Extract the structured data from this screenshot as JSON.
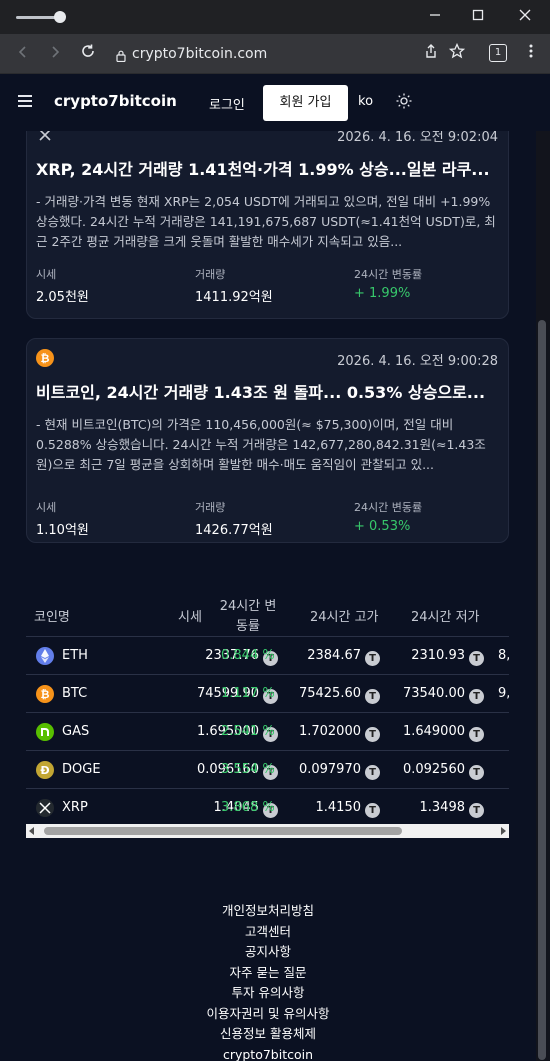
{
  "browser": {
    "url": "crypto7bitcoin.com",
    "tab_count": "1",
    "icons": [
      "back-arrow-icon",
      "forward-arrow-icon",
      "reload-icon",
      "lock-icon",
      "share-icon",
      "star-icon",
      "tab-count-icon",
      "more-icon"
    ]
  },
  "nav": {
    "brand": "crypto7bitcoin",
    "login": "로그인",
    "signup": "회원 가입",
    "lang": "ko"
  },
  "cards": [
    {
      "coin_icon": "xrp-icon",
      "time": "2026. 4. 16. 오전 9:02:04",
      "title": "XRP, 24시간 거래량 1.41천억·가격 1.99% 상승...일본 라쿠...",
      "body": "- 거래량·가격 변동 현재 XRP는 2,054 USDT에 거래되고 있으며, 전일 대비 +1.99% 상승했다. 24시간 누적 거래량은 141,191,675,687 USDT(≈1.41천억 USDT)로, 최근 2주간 평균 거래량을 크게 웃돌며 활발한 매수세가 지속되고 있음...",
      "price_label": "시세",
      "price": "2.05천원",
      "volume_label": "거래량",
      "volume": "1411.92억원",
      "change_label": "24시간 변동률",
      "change": "+ 1.99%"
    },
    {
      "coin_icon": "bitcoin-icon",
      "time": "2026. 4. 16. 오전 9:00:28",
      "title": "비트코인, 24시간 거래량 1.43조 원 돌파... 0.53% 상승으로...",
      "body": "- 현재 비트코인(BTC)의 가격은 110,456,000원(≈ $75,300)이며, 전일 대비 0.5288% 상승했습니다. 24시간 누적 거래량은 142,677,280,842.31원(≈1.43조 원)으로 최근 7일 평균을 상회하며 활발한 매수·매도 움직임이 관찰되고 있...",
      "price_label": "시세",
      "price": "1.10억원",
      "volume_label": "거래량",
      "volume": "1426.77억원",
      "change_label": "24시간 변동률",
      "change": "+ 0.53%"
    }
  ],
  "table": {
    "headers": {
      "name": "코인명",
      "price": "시세",
      "change_line1": "24시간 변",
      "change_line2": "동률",
      "high": "24시간 고가",
      "low": "24시간 저가"
    },
    "rows": [
      {
        "icon": "ethereum-icon",
        "icon_color": "#627eea",
        "name": "ETH",
        "price": "2337.76",
        "change": "0.844 %",
        "high": "2384.67",
        "low": "2310.93",
        "extra": "8,"
      },
      {
        "icon": "bitcoin-icon",
        "icon_color": "#f7931a",
        "name": "BTC",
        "price": "74599.90",
        "change": "1.117 %",
        "high": "75425.60",
        "low": "73540.00",
        "extra": "9,"
      },
      {
        "icon": "gas-icon",
        "icon_color": "#58bf00",
        "name": "GAS",
        "price": "1.695000",
        "change": "2.541 %",
        "high": "1.702000",
        "low": "1.649000",
        "extra": ""
      },
      {
        "icon": "dogecoin-icon",
        "icon_color": "#c2a633",
        "name": "DOGE",
        "price": "0.096160",
        "change": "3.554 %",
        "high": "0.097970",
        "low": "0.092560",
        "extra": ""
      },
      {
        "icon": "xrp-icon",
        "icon_color": "#23292f",
        "name": "XRP",
        "price": "1.4045",
        "change": "3.868 %",
        "high": "1.4150",
        "low": "1.3498",
        "extra": ""
      }
    ],
    "tether_badge": "T"
  },
  "footer": {
    "links": [
      "개인정보처리방침",
      "고객센터",
      "공지사항",
      "자주 묻는 질문",
      "투자 유의사항",
      "이용자권리 및 유의사항",
      "신용정보 활용체제",
      "crypto7bitcoin"
    ]
  }
}
